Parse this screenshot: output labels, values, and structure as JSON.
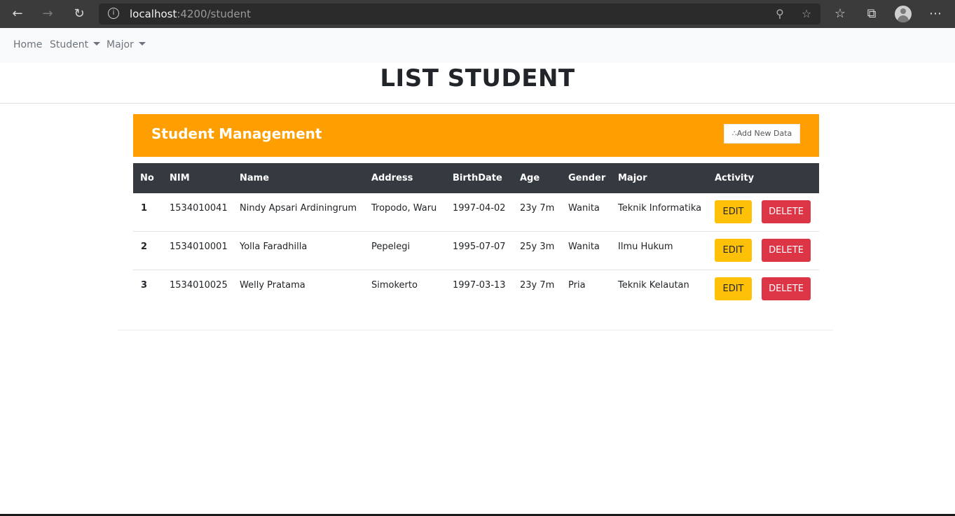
{
  "browser": {
    "url_host": "localhost",
    "url_path": ":4200/student",
    "icons": [
      "back-arrow-icon",
      "forward-arrow-icon",
      "refresh-icon",
      "info-icon",
      "zoom-icon",
      "star-icon",
      "favorites-icon",
      "collections-icon",
      "profile-avatar",
      "more-icon"
    ]
  },
  "nav": {
    "home": "Home",
    "student": "Student",
    "major": "Major"
  },
  "page": {
    "title": "LIST STUDENT"
  },
  "card": {
    "title_part1": "Student",
    "title_part2": "Management",
    "add_button": "∴Add New Data",
    "accent": "#ff9e00"
  },
  "table": {
    "headers": [
      "No",
      "NIM",
      "Name",
      "Address",
      "BirthDate",
      "Age",
      "Gender",
      "Major",
      "Activity"
    ],
    "rows": [
      {
        "no": "1",
        "nim": "1534010041",
        "name": "Nindy Apsari Ardiningrum",
        "address": "Tropodo, Waru",
        "birthdate": "1997-04-02",
        "age": "23y 7m",
        "gender": "Wanita",
        "major": "Teknik Informatika"
      },
      {
        "no": "2",
        "nim": "1534010001",
        "name": "Yolla Faradhilla",
        "address": "Pepelegi",
        "birthdate": "1995-07-07",
        "age": "25y 3m",
        "gender": "Wanita",
        "major": "Ilmu Hukum"
      },
      {
        "no": "3",
        "nim": "1534010025",
        "name": "Welly Pratama",
        "address": "Simokerto",
        "birthdate": "1997-03-13",
        "age": "23y 7m",
        "gender": "Pria",
        "major": "Teknik Kelautan"
      }
    ],
    "edit_label": "EDIT",
    "delete_label": "DELETE",
    "header_bg": "#343a40",
    "edit_color": "#ffc107",
    "delete_color": "#dc3545"
  }
}
